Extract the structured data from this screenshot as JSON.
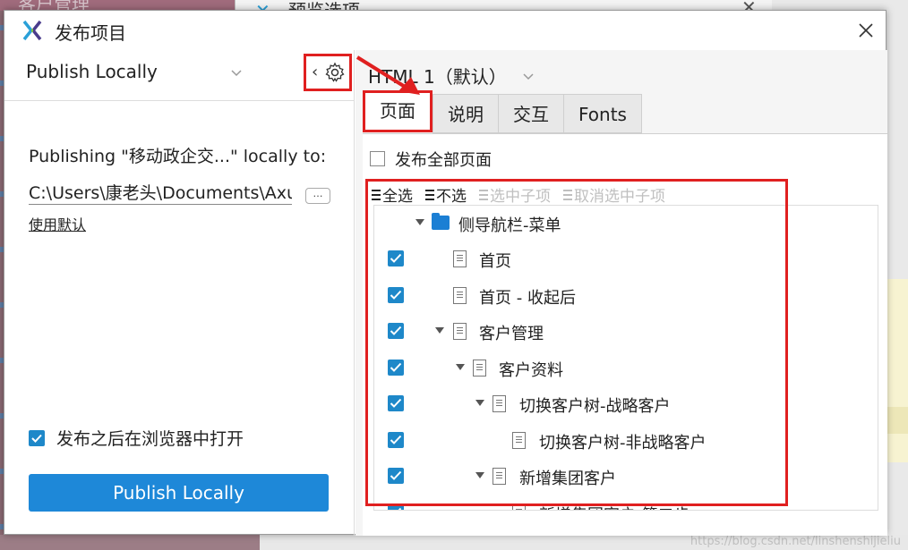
{
  "background": {
    "behind_title": "客户管理",
    "behind_window_title": "预览选项",
    "watermark": "https://blog.csdn.net/linshenshijieliu"
  },
  "dialog": {
    "title": "发布项目",
    "close_icon": "close-icon"
  },
  "left": {
    "publish_target": "Publish Locally",
    "publishing_text": "Publishing \"移动政企交...\" locally to:",
    "path_value": "C:\\Users\\康老头\\Documents\\Axure",
    "browse_label": "…",
    "use_default": "使用默认",
    "open_after_label": "发布之后在浏览器中打开",
    "open_after_checked": true,
    "publish_button": "Publish Locally"
  },
  "right": {
    "html_target": "HTML 1（默认）",
    "tabs": [
      {
        "label": "页面",
        "active": true
      },
      {
        "label": "说明",
        "active": false
      },
      {
        "label": "交互",
        "active": false
      },
      {
        "label": "Fonts",
        "active": false
      }
    ],
    "publish_all_pages": "发布全部页面",
    "toolbar": {
      "select_all": "全选",
      "select_none": "不选",
      "select_children": "选中子项",
      "deselect_children": "取消选中子项"
    },
    "tree": [
      {
        "label": "侧导航栏-菜单",
        "type": "folder",
        "checked": false
      },
      {
        "label": "首页",
        "type": "page",
        "checked": true
      },
      {
        "label": "首页 - 收起后",
        "type": "page",
        "checked": true
      },
      {
        "label": "客户管理",
        "type": "page",
        "checked": true
      },
      {
        "label": "客户资料",
        "type": "page",
        "checked": true
      },
      {
        "label": "切换客户树-战略客户",
        "type": "page",
        "checked": true
      },
      {
        "label": "切换客户树-非战略客户",
        "type": "page",
        "checked": true
      },
      {
        "label": "新增集团客户",
        "type": "page",
        "checked": true
      },
      {
        "label": "新增集团客户-第二步",
        "type": "page",
        "checked": true
      }
    ]
  },
  "colors": {
    "accent": "#1e88d8",
    "highlight": "#e02020",
    "folder": "#1b7fd4"
  }
}
